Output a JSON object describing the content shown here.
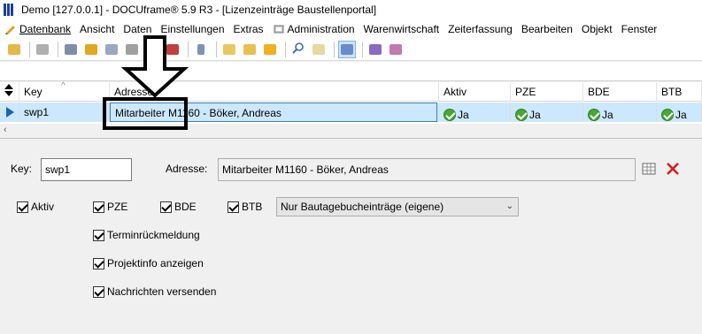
{
  "window": {
    "title": "Demo [127.0.0.1] - DOCUframe® 5.9 R3 - [Lizenzeinträge Baustellenportal]"
  },
  "menu": [
    {
      "label": "Datenbank",
      "icon": "app-menu-icon"
    },
    {
      "label": "Ansicht"
    },
    {
      "label": "Daten"
    },
    {
      "label": "Einstellungen"
    },
    {
      "label": "Extras"
    },
    {
      "label": "Administration",
      "icon": "admin-icon"
    },
    {
      "label": "Warenwirtschaft"
    },
    {
      "label": "Zeiterfassung"
    },
    {
      "label": "Bearbeiten"
    },
    {
      "label": "Objekt"
    },
    {
      "label": "Fenster"
    }
  ],
  "grid": {
    "headers": {
      "key": "Key",
      "adresse": "Adresse",
      "aktiv": "Aktiv",
      "pze": "PZE",
      "bde": "BDE",
      "btb": "BTB"
    },
    "rows": [
      {
        "key": "swp1",
        "adresse": "Mitarbeiter M1160 - Böker, Andreas",
        "aktiv": "Ja",
        "pze": "Ja",
        "bde": "Ja",
        "btb": "Ja"
      }
    ]
  },
  "form": {
    "key_label": "Key:",
    "key_value": "swp1",
    "adresse_label": "Adresse:",
    "adresse_value": "Mitarbeiter M1160 - Böker, Andreas",
    "checkboxes": {
      "aktiv": {
        "label": "Aktiv",
        "checked": true
      },
      "pze": {
        "label": "PZE",
        "checked": true
      },
      "bde": {
        "label": "BDE",
        "checked": true
      },
      "btb": {
        "label": "BTB",
        "checked": true
      },
      "terminrueckmeldung": {
        "label": "Terminrückmeldung",
        "checked": true
      },
      "projektinfo": {
        "label": "Projektinfo anzeigen",
        "checked": true
      },
      "nachrichten": {
        "label": "Nachrichten versenden",
        "checked": true
      }
    },
    "btb_mode": "Nur Bautagebucheinträge (eigene)"
  },
  "colors": {
    "selection": "#cce8ff",
    "check_green": "#48a832",
    "delete_red": "#d42020"
  }
}
